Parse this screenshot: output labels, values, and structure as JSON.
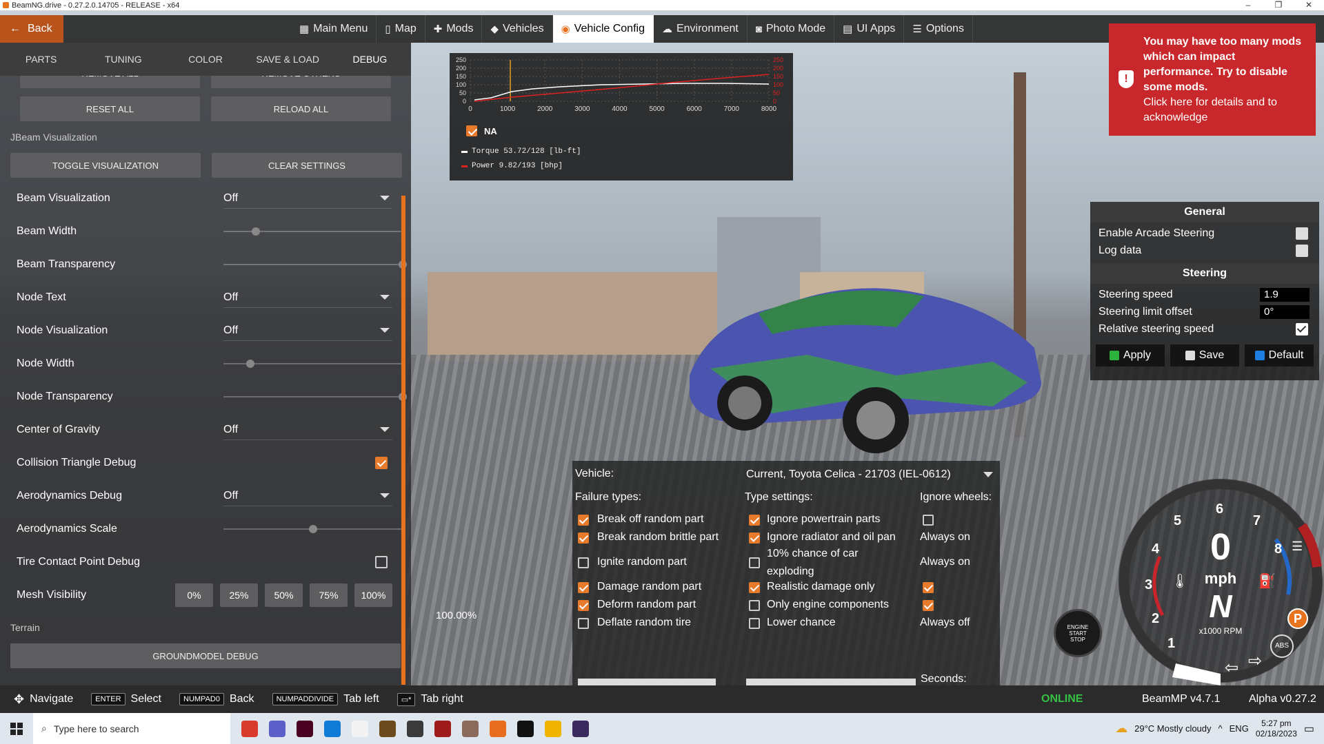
{
  "window": {
    "title": "BeamNG.drive - 0.27.2.0.14705 - RELEASE - x64",
    "controls": [
      "–",
      "❐",
      "✕"
    ]
  },
  "nav": {
    "back": "Back",
    "items": [
      {
        "label": "Main Menu",
        "icon": "main-menu-icon"
      },
      {
        "label": "Map",
        "icon": "map-icon"
      },
      {
        "label": "Mods",
        "icon": "puzzle-icon"
      },
      {
        "label": "Vehicles",
        "icon": "car-icon"
      },
      {
        "label": "Vehicle Config",
        "icon": "vehicle-config-icon",
        "active": true
      },
      {
        "label": "Environment",
        "icon": "weather-icon"
      },
      {
        "label": "Photo Mode",
        "icon": "camera-icon"
      },
      {
        "label": "UI Apps",
        "icon": "ui-apps-icon"
      },
      {
        "label": "Options",
        "icon": "options-icon"
      }
    ]
  },
  "left": {
    "tabs": [
      "PARTS",
      "TUNING",
      "COLOR",
      "SAVE & LOAD",
      "DEBUG"
    ],
    "remove_all": "REMOVE ALL",
    "remove_others": "REMOVE OTHERS",
    "reset_all": "RESET ALL",
    "reload_all": "RELOAD ALL",
    "jbeam_section": "JBeam Visualization",
    "toggle_vis": "TOGGLE VISUALIZATION",
    "clear_settings": "CLEAR SETTINGS",
    "rows": {
      "beam_vis": {
        "label": "Beam Visualization",
        "value": "Off"
      },
      "beam_width": {
        "label": "Beam Width",
        "level": 0.18
      },
      "beam_transparency": {
        "label": "Beam Transparency",
        "level": 1.0
      },
      "node_text": {
        "label": "Node Text",
        "value": "Off"
      },
      "node_vis": {
        "label": "Node Visualization",
        "value": "Off"
      },
      "node_width": {
        "label": "Node Width",
        "level": 0.15
      },
      "node_transparency": {
        "label": "Node Transparency",
        "level": 1.0
      },
      "cog": {
        "label": "Center of Gravity",
        "value": "Off"
      },
      "collision": {
        "label": "Collision Triangle Debug",
        "checked": true
      },
      "aero_debug": {
        "label": "Aerodynamics Debug",
        "value": "Off"
      },
      "aero_scale": {
        "label": "Aerodynamics Scale",
        "level": 0.5
      },
      "tire_contact": {
        "label": "Tire Contact Point Debug",
        "checked": false
      },
      "mesh_vis": {
        "label": "Mesh Visibility",
        "options": [
          "0%",
          "25%",
          "50%",
          "75%",
          "100%"
        ]
      }
    },
    "terrain_section": "Terrain",
    "groundmodel": "GROUNDMODEL DEBUG",
    "background_readout": "100.00%"
  },
  "graph": {
    "yticks": [
      "250",
      "200",
      "150",
      "100",
      "50",
      "0"
    ],
    "xticks": [
      "0",
      "1000",
      "2000",
      "3000",
      "4000",
      "5000",
      "6000",
      "7000",
      "8000"
    ],
    "checkbox_label": "NA",
    "torque_legend": "Torque 53.72/128 [lb-ft]",
    "power_legend": "Power  9.82/193  [bhp]",
    "torque_color": "#ffffff",
    "power_color": "#e0201e"
  },
  "warning": {
    "head": "You may have too many mods which can impact performance. Try to disable some mods.",
    "body": "Click here for details and to acknowledge",
    "color": "#c8272b"
  },
  "steering": {
    "general": "General",
    "arcade": "Enable Arcade Steering",
    "log": "Log data",
    "steering_head": "Steering",
    "speed_label": "Steering speed",
    "speed_val": "1.9",
    "limit_label": "Steering limit offset",
    "limit_val": "0°",
    "relative_label": "Relative steering speed",
    "apply": "Apply",
    "save": "Save",
    "default": "Default"
  },
  "failure": {
    "vehicle_label": "Vehicle:",
    "vehicle_value": "Current, Toyota Celica - 21703 (IEL-0612)",
    "failure_types": "Failure types:",
    "type_settings": "Type settings:",
    "ignore_wheels": "Ignore wheels:",
    "items": [
      {
        "label": "Break off random part",
        "checked": true
      },
      {
        "label": "Break random brittle part",
        "checked": true
      },
      {
        "label": "Ignite random part",
        "checked": false
      },
      {
        "label": "Damage random part",
        "checked": true
      },
      {
        "label": "Deform random part",
        "checked": true
      },
      {
        "label": "Deflate random tire",
        "checked": false
      }
    ],
    "settings": [
      {
        "label": "Ignore powertrain parts",
        "checked": true
      },
      {
        "label": "Ignore radiator and oil pan",
        "checked": true
      },
      {
        "label": "10% chance of car",
        "label2": "exploding",
        "checked": false
      },
      {
        "label": "Realistic damage only",
        "checked": true
      },
      {
        "label": "Only engine components",
        "checked": false
      },
      {
        "label": "Lower chance",
        "checked": false
      }
    ],
    "wheels": [
      "",
      "Always on",
      "Always on",
      "",
      "",
      "Always off"
    ],
    "seconds": "Seconds:"
  },
  "gauge": {
    "ticks": [
      "1",
      "2",
      "3",
      "4",
      "5",
      "6",
      "7",
      "8"
    ],
    "speed": "0",
    "unit": "mph",
    "gear": "N",
    "rpm_label": "x1000 RPM",
    "abs": "ABS",
    "park": "P",
    "startstop": [
      "ENGINE",
      "START",
      "STOP"
    ]
  },
  "bottom": {
    "hints": [
      {
        "key": "✥",
        "label": "Navigate"
      },
      {
        "key": "ENTER",
        "label": "Select"
      },
      {
        "key": "NUMPAD0",
        "label": "Back"
      },
      {
        "key": "NUMPADDIVIDE",
        "label": "Tab left"
      },
      {
        "key": "▭*",
        "label": "Tab right"
      }
    ],
    "online": "ONLINE",
    "beammp": "BeamMP v4.7.1",
    "alpha": "Alpha v0.27.2"
  },
  "taskbar": {
    "search": "Type here to search",
    "apps": [
      "#d83b2b",
      "#5b5fc7",
      "#49021f",
      "#0f7bd6",
      "#f3f3f3",
      "#6b4a1e",
      "#3a3a3a",
      "#9e1b1b",
      "#8a6a5a",
      "#e86d1f",
      "#111111",
      "#f0b400",
      "#3a2a5e"
    ],
    "weather": "29°C  Mostly cloudy",
    "lang": "ENG",
    "time": "5:27 pm",
    "date": "02/18/2023"
  }
}
